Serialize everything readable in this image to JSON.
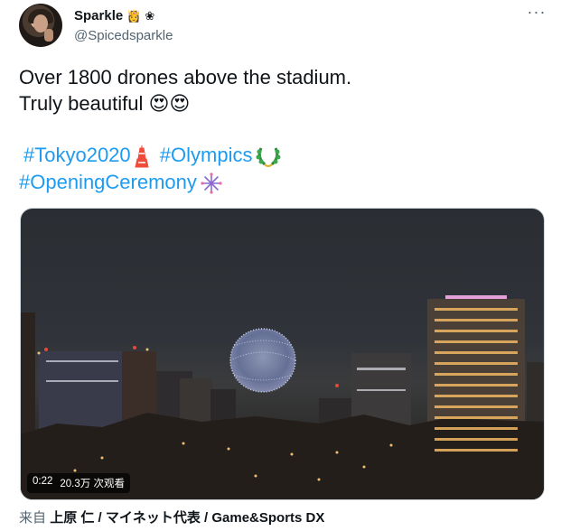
{
  "user": {
    "display_name": "Sparkle",
    "badges": [
      "👸",
      "❀"
    ],
    "handle": "@Spicedsparkle"
  },
  "tweet": {
    "line1": "Over 1800 drones above the stadium.",
    "line2": "Truly beautiful",
    "line2_emoji": "😍😍",
    "hashtags": [
      "#Tokyo2020",
      "#Olympics",
      "#OpeningCeremony"
    ],
    "hashtag_icons": [
      "tokyo-tower-icon",
      "laurel-icon",
      "fireworks-icon"
    ]
  },
  "media": {
    "time": "0:22",
    "views": "20.3万 次观看"
  },
  "source": {
    "label": "来自",
    "credit": "上原 仁 / マイネット代表 / Game&Sports DX"
  },
  "colors": {
    "accent": "#1d9bf0",
    "text": "#0f1419",
    "muted": "#536471"
  }
}
